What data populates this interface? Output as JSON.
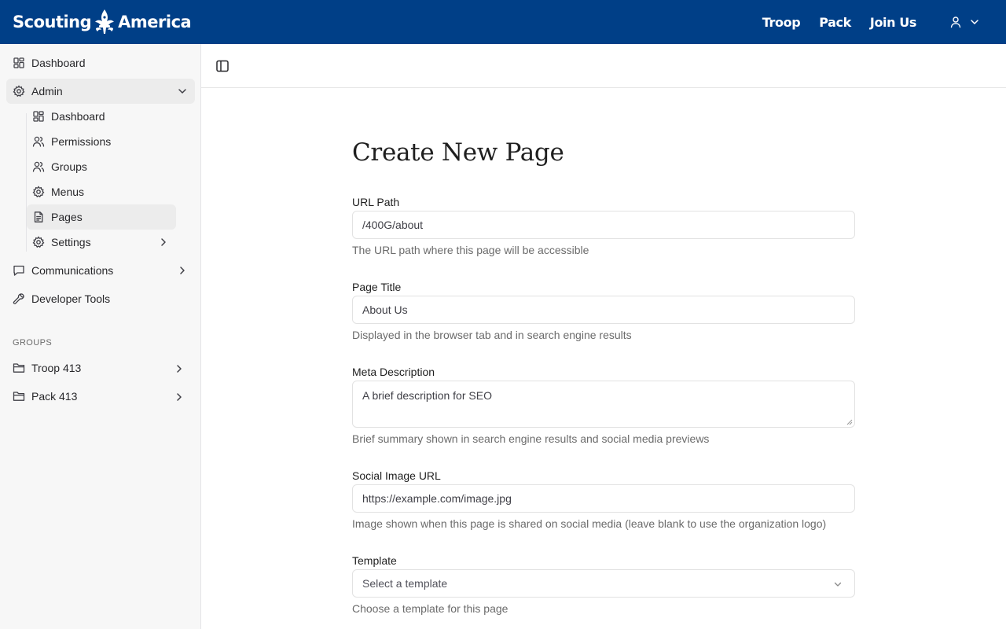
{
  "header": {
    "logo_left": "Scouting",
    "logo_right": "America",
    "nav": [
      "Troop",
      "Pack",
      "Join Us"
    ],
    "user_icon": "user-icon"
  },
  "sidebar": {
    "items": [
      {
        "label": "Dashboard",
        "icon": "dashboard-icon"
      },
      {
        "label": "Admin",
        "icon": "gear-icon",
        "expanded": true
      },
      {
        "label": "Dashboard",
        "icon": "dashboard-icon"
      },
      {
        "label": "Permissions",
        "icon": "users-icon"
      },
      {
        "label": "Groups",
        "icon": "users-icon"
      },
      {
        "label": "Menus",
        "icon": "gear-icon"
      },
      {
        "label": "Pages",
        "icon": "document-icon",
        "active": true
      },
      {
        "label": "Settings",
        "icon": "gear-icon"
      },
      {
        "label": "Communications",
        "icon": "chat-icon"
      },
      {
        "label": "Developer Tools",
        "icon": "wrench-icon"
      }
    ],
    "groups_label": "GROUPS",
    "groups": [
      {
        "label": "Troop 413",
        "icon": "folder-icon"
      },
      {
        "label": "Pack 413",
        "icon": "folder-icon"
      }
    ]
  },
  "main": {
    "title": "Create New Page",
    "fields": {
      "url_path": {
        "label": "URL Path",
        "value": "/400G/about",
        "help": "The URL path where this page will be accessible"
      },
      "page_title": {
        "label": "Page Title",
        "value": "About Us",
        "help": "Displayed in the browser tab and in search engine results"
      },
      "meta_description": {
        "label": "Meta Description",
        "placeholder": "A brief description for SEO",
        "help": "Brief summary shown in search engine results and social media previews"
      },
      "social_image": {
        "label": "Social Image URL",
        "placeholder": "https://example.com/image.jpg",
        "help": "Image shown when this page is shared on social media (leave blank to use the organization logo)"
      },
      "template": {
        "label": "Template",
        "placeholder": "Select a template",
        "help": "Choose a template for this page"
      }
    }
  },
  "colors": {
    "header_bg": "#003f87",
    "sidebar_bg": "#f7f7f7",
    "active_item_bg": "#ececec"
  }
}
